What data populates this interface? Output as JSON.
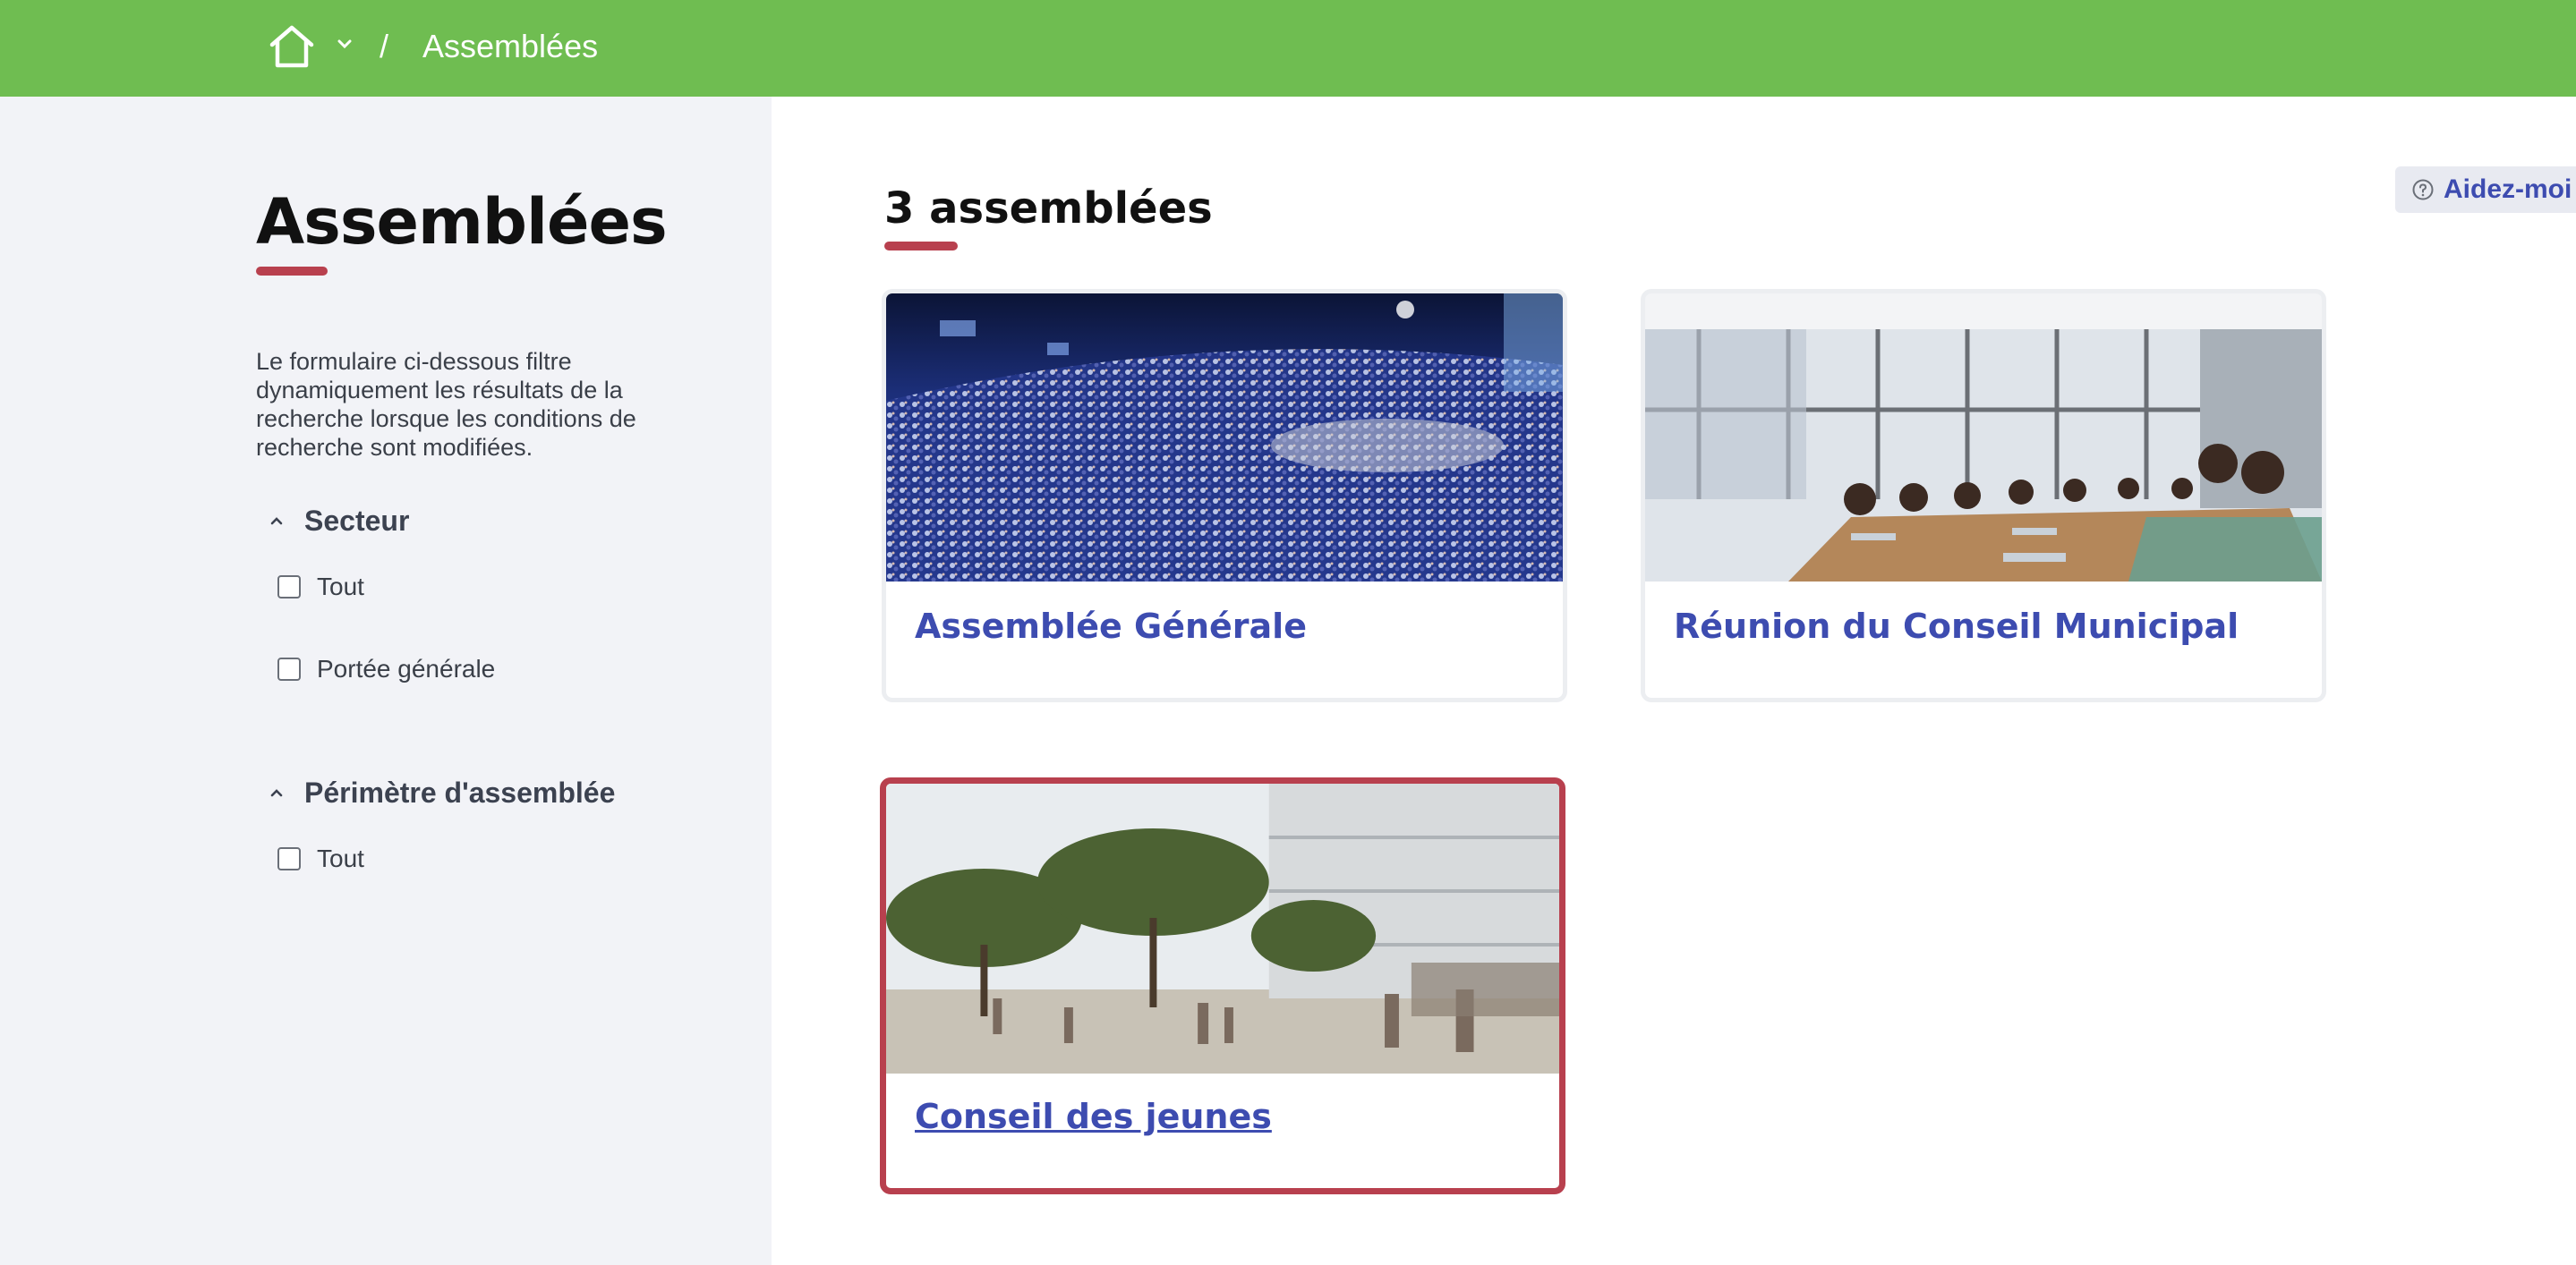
{
  "header": {
    "home_icon": "home-icon",
    "menu_icon": "chevron-down-icon",
    "separator": "/",
    "current": "Assemblées",
    "bg_color": "#6fbd51"
  },
  "sidebar": {
    "title": "Assemblées",
    "description": "Le formulaire ci-dessous filtre dynamiquement les résultats de la recherche lorsque les conditions de recherche sont modifiées.",
    "filters": [
      {
        "label": "Secteur",
        "expanded": true,
        "options": [
          {
            "label": "Tout",
            "checked": false
          },
          {
            "label": "Portée générale",
            "checked": false
          }
        ]
      },
      {
        "label": "Périmètre d'assemblée",
        "expanded": true,
        "options": [
          {
            "label": "Tout",
            "checked": false
          }
        ]
      }
    ]
  },
  "main": {
    "count_title": "3 assemblées",
    "help_label": "Aidez-moi",
    "help_icon": "question-circle-icon",
    "cards": [
      {
        "title": "Assemblée Générale",
        "image": "auditorium-crowd-photo",
        "focused": false
      },
      {
        "title": "Réunion du Conseil Municipal",
        "image": "meeting-room-photo",
        "focused": false
      },
      {
        "title": "Conseil des jeunes",
        "image": "public-square-photo",
        "focused": true
      }
    ]
  },
  "colors": {
    "accent": "#b8404e",
    "link": "#3d4cb0",
    "sidebar_bg": "#f2f3f7"
  }
}
